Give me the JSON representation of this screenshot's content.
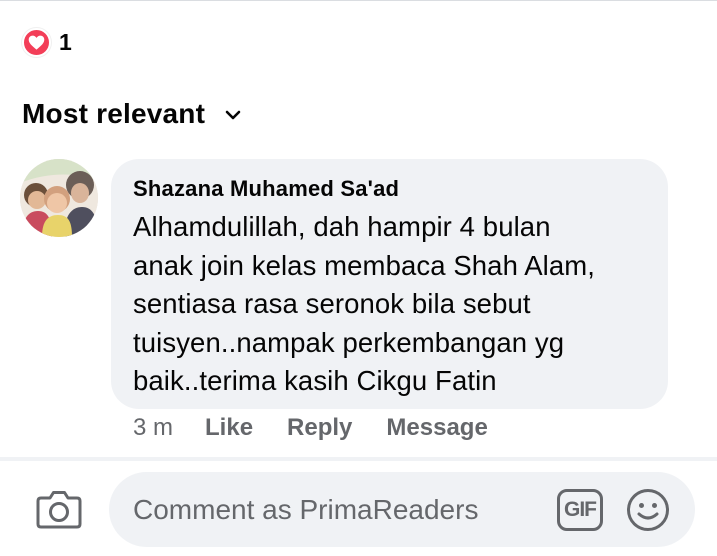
{
  "reactions": {
    "icon": "heart-icon",
    "color": "#f33e58",
    "count": "1"
  },
  "sort": {
    "label": "Most relevant",
    "icon": "chevron-down-icon"
  },
  "comment": {
    "author": "Shazana Muhamed Sa'ad",
    "text_lines": [
      "Alhamdulillah, dah hampir 4 bulan",
      "anak join kelas membaca Shah Alam,",
      "sentiasa rasa seronok bila sebut",
      "tuisyen..nampak perkembangan yg",
      "baik..terima kasih Cikgu Fatin"
    ],
    "time": "3 m",
    "actions": [
      "Like",
      "Reply",
      "Message"
    ]
  },
  "composer": {
    "placeholder": "Comment as PrimaReaders",
    "camera_icon": "camera-icon",
    "gif_label": "GIF",
    "emoji_icon": "smiley-icon"
  },
  "colors": {
    "text": "#050505",
    "secondary_text": "#65676b",
    "bubble": "#f0f2f5"
  }
}
